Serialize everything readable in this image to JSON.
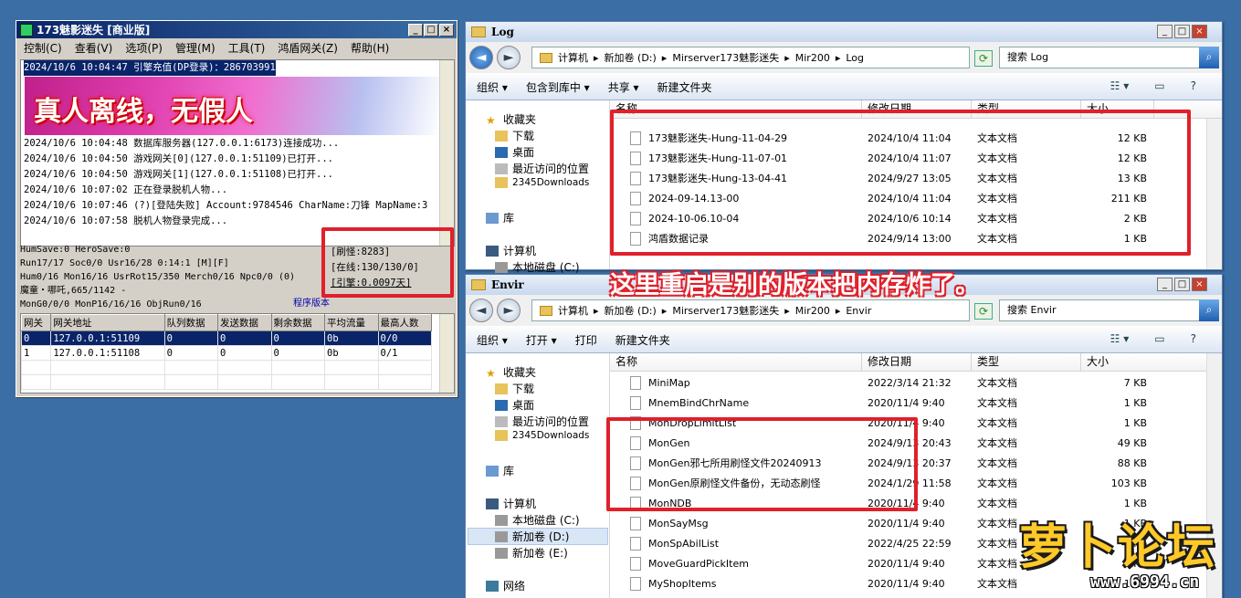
{
  "m2": {
    "title": "173魅影迷失 [商业版]",
    "controls": [
      "_",
      "□",
      "×"
    ],
    "menu": [
      "控制(C)",
      "查看(V)",
      "选项(P)",
      "管理(M)",
      "工具(T)",
      "鸿盾网关(Z)",
      "帮助(H)"
    ],
    "log_top_line": "2024/10/6 10:04:47 引擎充值(DP登录)：286703991",
    "banner_text": "真人离线，无假人",
    "log_lines": [
      "2024/10/6 10:04:48 数据库服务器(127.0.0.1:6173)连接成功...",
      "2024/10/6 10:04:50 游戏网关[0](127.0.0.1:51109)已打开...",
      "2024/10/6 10:04:50 游戏网关[1](127.0.0.1:51108)已打开...",
      "2024/10/6 10:07:02 正在登录脱机人物...",
      "2024/10/6 10:07:46 (?)[登陆失败] Account:9784546 CharName:刀锋 MapName:3",
      "2024/10/6 10:07:58 脱机人物登录完成..."
    ],
    "status_lines": [
      "HumSave:0 HeroSave:0",
      "Run17/17 Soc0/0 Usr16/28          0:14:1 [M][F]",
      "Hum0/16 Mon16/16 UsrRot15/350 Merch0/16 Npc0/0 (0)",
      "魔童・哪吒,665/1142 -",
      "MonG0/0/0 MonP16/16/16 ObjRun0/16"
    ],
    "stat_refresh": "[刷怪:8283]",
    "stat_online": "[在线:130/130/0]",
    "stat_engine": "[引擎:0.0097天]",
    "footer_link": "程序版本",
    "gate_headers": [
      "网关",
      "网关地址",
      "队列数据",
      "发送数据",
      "剩余数据",
      "平均流量",
      "最高人数"
    ],
    "gate_rows": [
      [
        "0",
        "127.0.0.1:51109",
        "0",
        "0",
        "0",
        "0b",
        "0/0"
      ],
      [
        "1",
        "127.0.0.1:51108",
        "0",
        "0",
        "0",
        "0b",
        "0/1"
      ]
    ]
  },
  "log_window": {
    "title": "Log",
    "address": [
      "计算机",
      "新加卷 (D:)",
      "Mirserver173魅影迷失",
      "Mir200",
      "Log"
    ],
    "search_placeholder": "搜索 Log",
    "toolbar": [
      "组织 ▾",
      "包含到库中 ▾",
      "共享 ▾",
      "新建文件夹"
    ],
    "nav_items": [
      "收藏夹",
      "下载",
      "桌面",
      "最近访问的位置",
      "2345Downloads",
      "库",
      "计算机",
      "本地磁盘 (C:)"
    ],
    "headers": [
      "名称",
      "修改日期",
      "类型",
      "大小"
    ],
    "files": [
      [
        "173魅影迷失-Hung-11-04-29",
        "2024/10/4 11:04",
        "文本文档",
        "12 KB"
      ],
      [
        "173魅影迷失-Hung-11-07-01",
        "2024/10/4 11:07",
        "文本文档",
        "12 KB"
      ],
      [
        "173魅影迷失-Hung-13-04-41",
        "2024/9/27 13:05",
        "文本文档",
        "13 KB"
      ],
      [
        "2024-09-14.13-00",
        "2024/10/4 11:04",
        "文本文档",
        "211 KB"
      ],
      [
        "2024-10-06.10-04",
        "2024/10/6 10:14",
        "文本文档",
        "2 KB"
      ],
      [
        "鸿盾数据记录",
        "2024/9/14 13:00",
        "文本文档",
        "1 KB"
      ]
    ]
  },
  "envir_window": {
    "title": "Envir",
    "address": [
      "计算机",
      "新加卷 (D:)",
      "Mirserver173魅影迷失",
      "Mir200",
      "Envir"
    ],
    "search_placeholder": "搜索 Envir",
    "toolbar": [
      "组织 ▾",
      "打开 ▾",
      "打印",
      "新建文件夹"
    ],
    "nav_items": [
      "收藏夹",
      "下载",
      "桌面",
      "最近访问的位置",
      "2345Downloads",
      "库",
      "计算机",
      "本地磁盘 (C:)",
      "新加卷 (D:)",
      "新加卷 (E:)",
      "网络"
    ],
    "headers": [
      "名称",
      "修改日期",
      "类型",
      "大小"
    ],
    "files": [
      [
        "MiniMap",
        "2022/3/14 21:32",
        "文本文档",
        "7 KB"
      ],
      [
        "MnemBindChrName",
        "2020/11/4 9:40",
        "文本文档",
        "1 KB"
      ],
      [
        "MonDropLimitList",
        "2020/11/4 9:40",
        "文本文档",
        "1 KB"
      ],
      [
        "MonGen",
        "2024/9/13 20:43",
        "文本文档",
        "49 KB"
      ],
      [
        "MonGen邪七所用刷怪文件20240913",
        "2024/9/13 20:37",
        "文本文档",
        "88 KB"
      ],
      [
        "MonGen原刷怪文件备份，无动态刷怪",
        "2024/1/29 11:58",
        "文本文档",
        "103 KB"
      ],
      [
        "MonNDB",
        "2020/11/4 9:40",
        "文本文档",
        "1 KB"
      ],
      [
        "MonSayMsg",
        "2020/11/4 9:40",
        "文本文档",
        "1 KB"
      ],
      [
        "MonSpAbilList",
        "2022/4/25 22:59",
        "文本文档",
        "1 KB"
      ],
      [
        "MoveGuardPickItem",
        "2020/11/4 9:40",
        "文本文档",
        "1 KB"
      ],
      [
        "MyShopItems",
        "2020/11/4 9:40",
        "文本文档",
        "1 KB"
      ]
    ]
  },
  "annotation": "这里重启是别的版本把内存炸了。",
  "watermark": {
    "text": "萝卜论坛",
    "url": "www.6994.cn"
  },
  "colors": {
    "desktop": "#3a6ea5",
    "annotation_red": "#e0202a",
    "selection": "#0a246a"
  }
}
